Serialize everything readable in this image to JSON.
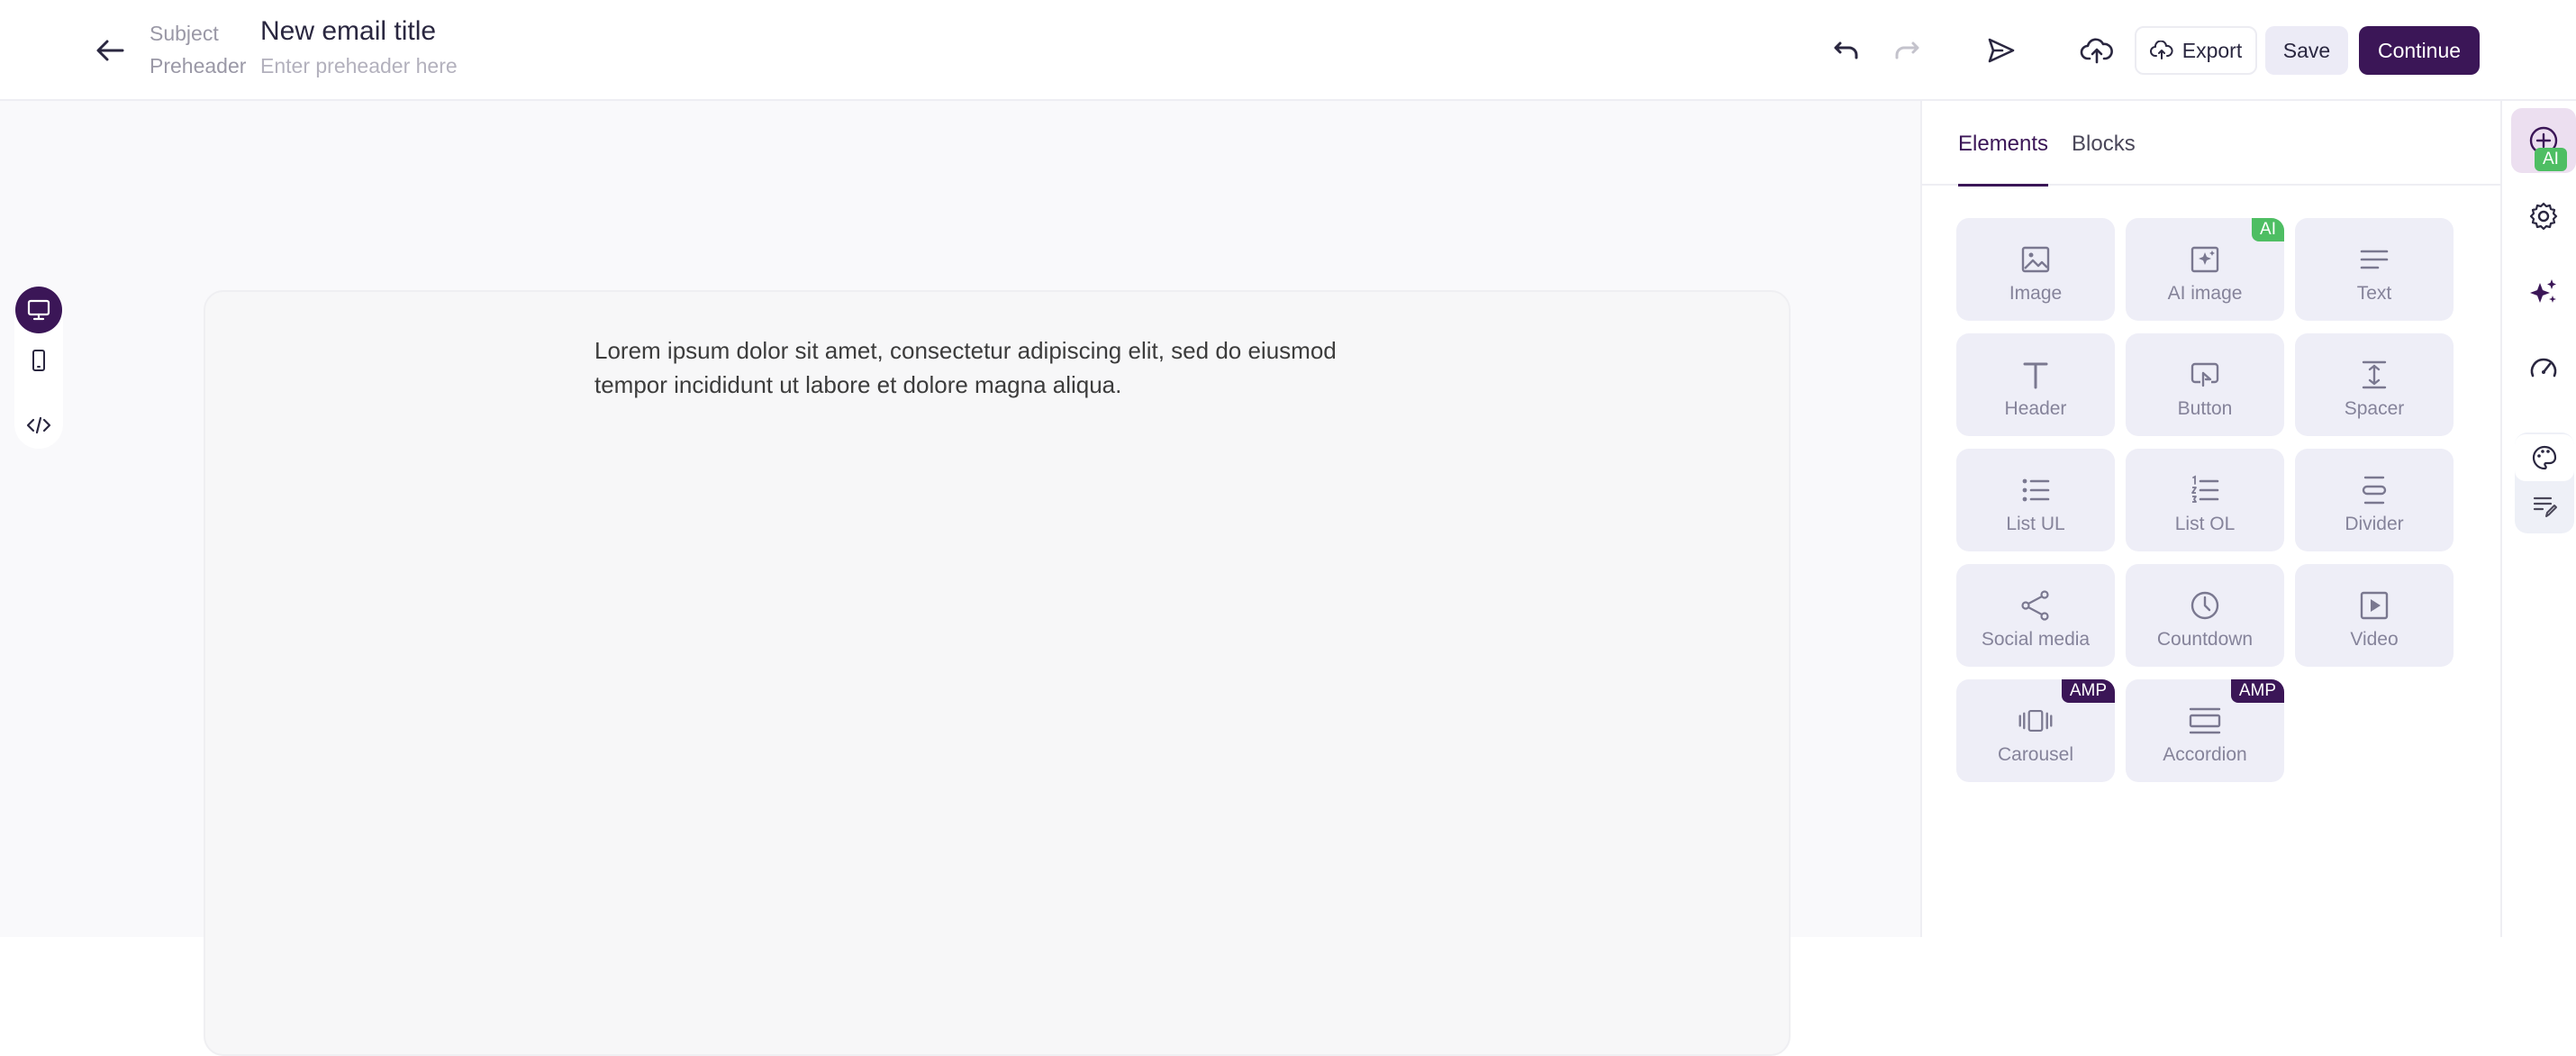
{
  "header": {
    "subject_label": "Subject",
    "subject_value": "New email title",
    "preheader_label": "Preheader",
    "preheader_placeholder": "Enter preheader here",
    "export_label": "Export",
    "save_label": "Save",
    "continue_label": "Continue",
    "icons": [
      "back-arrow-icon",
      "undo-icon",
      "redo-icon",
      "send-icon",
      "upload-cloud-icon",
      "cloud-export-icon"
    ]
  },
  "view_toggle": {
    "selected": "desktop",
    "icons": [
      "desktop-icon",
      "mobile-icon",
      "code-icon"
    ]
  },
  "email": {
    "body_text": "Lorem ipsum dolor sit amet, consectetur adipiscing elit, sed do eiusmod tempor incididunt ut labore et dolore magna aliqua."
  },
  "panel": {
    "tabs": [
      {
        "label": "Elements",
        "active": true
      },
      {
        "label": "Blocks",
        "active": false
      }
    ],
    "elements": [
      {
        "label": "Image",
        "icon": "image-icon",
        "badge": ""
      },
      {
        "label": "AI image",
        "icon": "ai-image-icon",
        "badge": "AI"
      },
      {
        "label": "Text",
        "icon": "text-icon",
        "badge": ""
      },
      {
        "label": "Header",
        "icon": "header-icon",
        "badge": ""
      },
      {
        "label": "Button",
        "icon": "button-icon",
        "badge": ""
      },
      {
        "label": "Spacer",
        "icon": "spacer-icon",
        "badge": ""
      },
      {
        "label": "List UL",
        "icon": "list-ul-icon",
        "badge": ""
      },
      {
        "label": "List OL",
        "icon": "list-ol-icon",
        "badge": ""
      },
      {
        "label": "Divider",
        "icon": "divider-icon",
        "badge": ""
      },
      {
        "label": "Social media",
        "icon": "share-icon",
        "badge": ""
      },
      {
        "label": "Countdown",
        "icon": "clock-icon",
        "badge": ""
      },
      {
        "label": "Video",
        "icon": "video-icon",
        "badge": ""
      },
      {
        "label": "Carousel",
        "icon": "carousel-icon",
        "badge": "AMP"
      },
      {
        "label": "Accordion",
        "icon": "accordion-icon",
        "badge": "AMP"
      }
    ]
  },
  "rail": {
    "ai_badge": "AI",
    "icons": [
      "plus-circle-icon",
      "gear-icon",
      "sparkles-icon",
      "speedometer-icon",
      "palette-icon",
      "edit-lines-icon"
    ]
  },
  "colors": {
    "brand": "#3b1657",
    "ai_badge": "#4ebe63",
    "tile_bg": "#eeeef7"
  }
}
